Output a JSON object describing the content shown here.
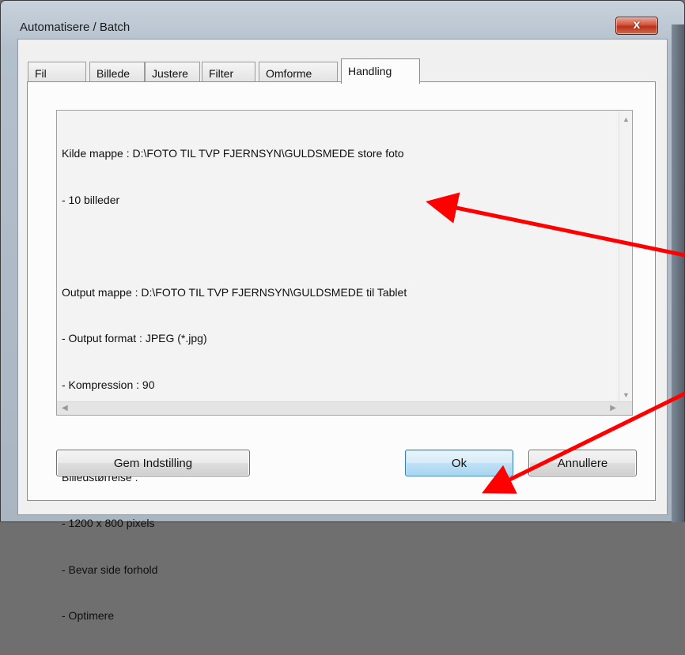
{
  "window": {
    "title": "Automatisere / Batch",
    "close_label": "x"
  },
  "tabs": [
    {
      "label": "Fil"
    },
    {
      "label": "Billede"
    },
    {
      "label": "Justere"
    },
    {
      "label": "Filter"
    },
    {
      "label": "Omforme"
    },
    {
      "label": "Handling"
    }
  ],
  "active_tab": "Handling",
  "summary": {
    "lines": [
      "Kilde mappe : D:\\FOTO TIL TVP FJERNSYN\\GULDSMEDE store foto",
      "- 10 billeder",
      "",
      "Output mappe : D:\\FOTO TIL TVP FJERNSYN\\GULDSMEDE til Tablet",
      "- Output format : JPEG (*.jpg)",
      "- Kompression : 90",
      "",
      "Billedstørrelse :",
      "- 1200 x 800 pixels",
      "- Bevar side forhold",
      "- Optimere"
    ]
  },
  "buttons": {
    "save_settings": "Gem Indstilling",
    "ok": "Ok",
    "cancel": "Annullere"
  },
  "colors": {
    "annotation_arrow": "#ff0000",
    "close_button": "#c9472e",
    "default_button": "#bfe0f4"
  }
}
